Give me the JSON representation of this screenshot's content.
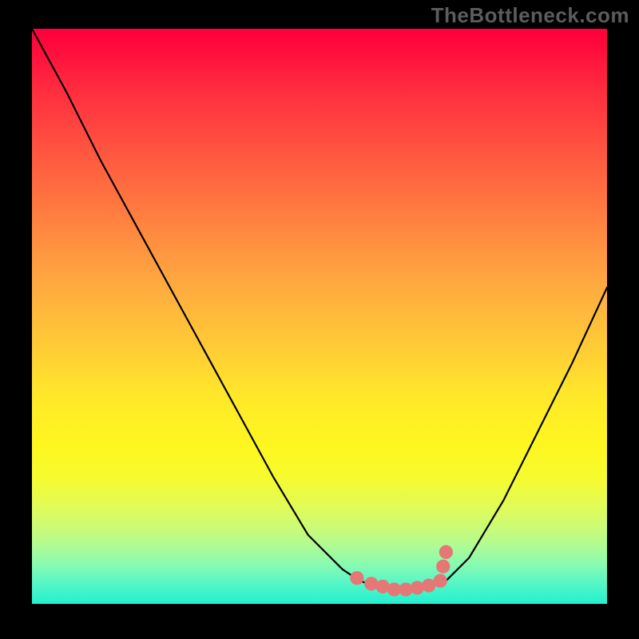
{
  "watermark": "TheBottleneck.com",
  "colors": {
    "frame": "#000000",
    "watermark": "#5c5c5c",
    "curve": "#000000",
    "dots": "#e67777"
  },
  "chart_data": {
    "type": "line",
    "title": "",
    "xlabel": "",
    "ylabel": "",
    "xlim": [
      0,
      100
    ],
    "ylim": [
      0,
      100
    ],
    "grid": false,
    "x": [
      0,
      6,
      12,
      18,
      24,
      30,
      36,
      42,
      48,
      54,
      57,
      60,
      63,
      66,
      69,
      72,
      76,
      82,
      88,
      94,
      100
    ],
    "values": [
      100,
      89,
      77,
      66,
      55,
      44,
      33,
      22,
      12,
      6,
      4,
      3,
      2.5,
      2.5,
      3,
      4,
      8,
      18,
      30,
      42,
      55
    ],
    "dots_x": [
      56.5,
      59,
      61,
      63,
      65,
      67,
      69,
      71,
      71.5,
      72
    ],
    "dots_y": [
      4.5,
      3.5,
      3,
      2.5,
      2.5,
      2.8,
      3.2,
      4,
      6.5,
      9
    ],
    "dot_radius_pct": 1.2
  }
}
